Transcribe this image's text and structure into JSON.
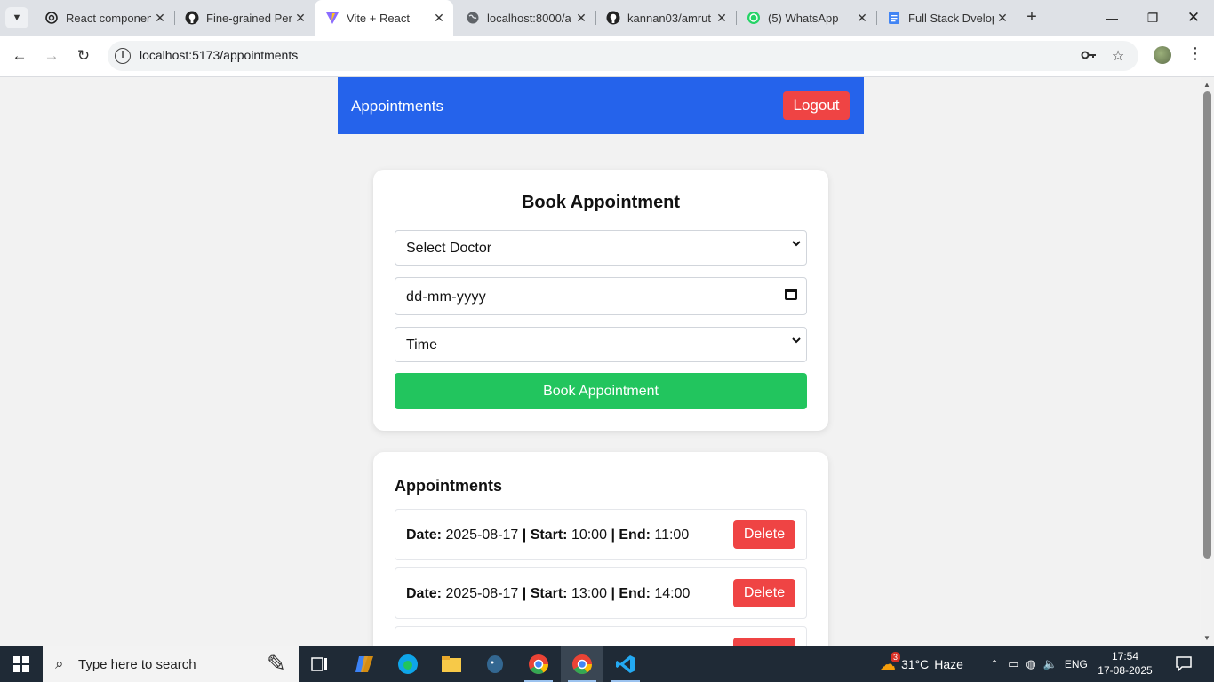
{
  "browser": {
    "tabs": [
      {
        "title": "React componen",
        "favicon": "openai-icon"
      },
      {
        "title": "Fine-grained Per",
        "favicon": "github-icon"
      },
      {
        "title": "Vite + React",
        "favicon": "vite-icon",
        "active": true
      },
      {
        "title": "localhost:8000/a",
        "favicon": "globe-icon"
      },
      {
        "title": "kannan03/amrut",
        "favicon": "github-icon"
      },
      {
        "title": "(5) WhatsApp",
        "favicon": "whatsapp-icon"
      },
      {
        "title": "Full Stack Dvelop",
        "favicon": "docs-icon"
      }
    ],
    "url": "localhost:5173/appointments"
  },
  "page": {
    "navbar": {
      "brand": "Appointments",
      "logout_label": "Logout"
    },
    "booking_form": {
      "title": "Book Appointment",
      "doctor_select": "Select Doctor",
      "date_placeholder": "dd-mm-yyyy",
      "time_select": "Time",
      "submit_label": "Book Appointment"
    },
    "appointments": {
      "title": "Appointments",
      "date_label": "Date:",
      "start_label": "Start:",
      "end_label": "End:",
      "separator": "|",
      "delete_label": "Delete",
      "items": [
        {
          "date": "2025-08-17",
          "start": "10:00",
          "end": "11:00"
        },
        {
          "date": "2025-08-17",
          "start": "13:00",
          "end": "14:00"
        }
      ]
    }
  },
  "taskbar": {
    "search_placeholder": "Type here to search",
    "weather": {
      "temp": "31°C",
      "condition": "Haze",
      "badge": "3"
    },
    "language": "ENG",
    "time": "17:54",
    "date": "17-08-2025"
  },
  "colors": {
    "navbar": "#2563eb",
    "danger": "#ef4444",
    "success": "#22c55e"
  }
}
